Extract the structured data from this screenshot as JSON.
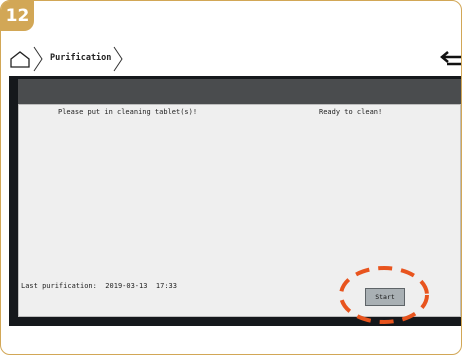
{
  "step_number": "12",
  "breadcrumb": {
    "home_icon": "home-icon",
    "current": "Purification"
  },
  "back_icon": "back-arrow-icon",
  "panel": {
    "instruction": "Please put in cleaning tablet(s)!",
    "status": "Ready to clean!",
    "last_purification_label": "Last purification:",
    "last_purification_date": "2019-03-13",
    "last_purification_time": "17:33",
    "start_label": "Start"
  },
  "colors": {
    "accent": "#d2a756",
    "highlight": "#e8541e",
    "screen_bg": "#15181c",
    "panel_bg": "#efefef",
    "button_bg": "#a9b0b4"
  }
}
